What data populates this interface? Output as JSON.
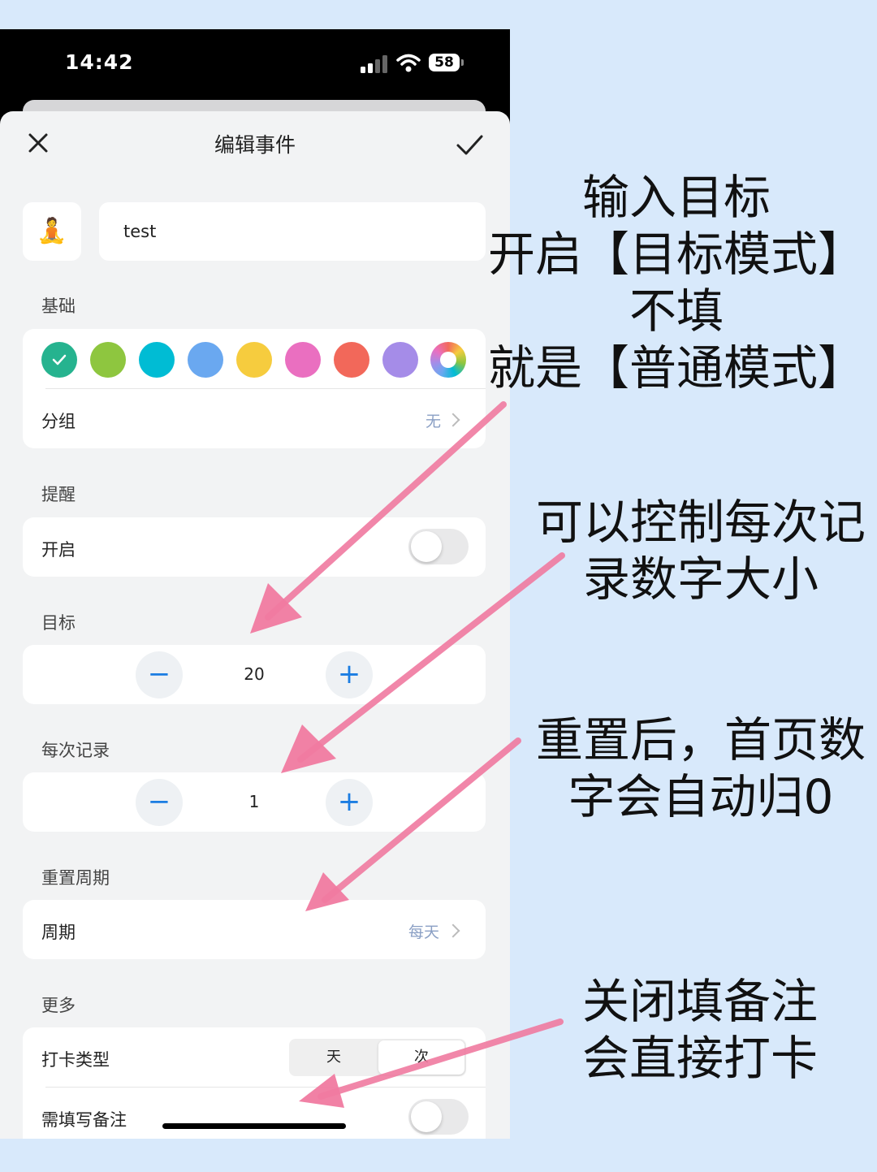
{
  "status_bar": {
    "time": "14:42",
    "battery": "58"
  },
  "nav": {
    "title": "编辑事件"
  },
  "event": {
    "emoji": "🧘",
    "name": "test"
  },
  "basics": {
    "label": "基础",
    "colors": [
      "#26b38f",
      "#8ec63f",
      "#00bcd4",
      "#6aa8f0",
      "#f6cc3e",
      "#ea6fc0",
      "#f2685a",
      "#a58ce8"
    ],
    "group_label": "分组",
    "group_value": "无"
  },
  "reminder": {
    "label": "提醒",
    "toggle_label": "开启"
  },
  "goal": {
    "label": "目标",
    "value": "20"
  },
  "per_record": {
    "label": "每次记录",
    "value": "1"
  },
  "reset": {
    "label": "重置周期",
    "row_label": "周期",
    "value": "每天"
  },
  "more": {
    "label": "更多",
    "checkin_type_label": "打卡类型",
    "checkin_options": [
      "天",
      "次"
    ],
    "note_label": "需填写备注"
  },
  "annotations": {
    "a1": [
      "输入目标",
      "开启【目标模式】",
      "不填",
      "就是【普通模式】"
    ],
    "a2": [
      "可以控制每次记",
      "录数字大小"
    ],
    "a3": [
      "重置后，首页数",
      "字会自动归0"
    ],
    "a4": [
      "关闭填备注",
      "会直接打卡"
    ]
  },
  "accent_colors": {
    "arrow": "#f07aa0",
    "stepper": "#1b7de2",
    "background": "#d8e9fb"
  }
}
